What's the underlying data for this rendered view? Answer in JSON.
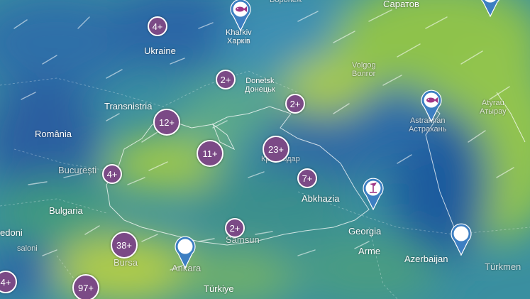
{
  "map": {
    "place_labels": [
      {
        "id": "ukraine",
        "text": "Ukraine"
      },
      {
        "id": "kharkiv",
        "text": "Kharkiv\nХарків"
      },
      {
        "id": "donetsk",
        "text": "Donetsk\nДонецьк"
      },
      {
        "id": "voronezh",
        "text": "Воронеж"
      },
      {
        "id": "saratov",
        "text": "Саратов"
      },
      {
        "id": "volgograd",
        "text": "Volgog\nВолгог"
      },
      {
        "id": "transnistria",
        "text": "Transnistria"
      },
      {
        "id": "romania",
        "text": "România"
      },
      {
        "id": "bucuresti",
        "text": "București"
      },
      {
        "id": "bulgaria",
        "text": "Bulgaria"
      },
      {
        "id": "krasnodar",
        "text": "odar\nКраснодар"
      },
      {
        "id": "astrakhan",
        "text": "Astrakhan\nАстрахань"
      },
      {
        "id": "atyrau",
        "text": "Atyrau\nАтырау"
      },
      {
        "id": "abkhazia",
        "text": "Abkhazia"
      },
      {
        "id": "georgia",
        "text": "Georgia"
      },
      {
        "id": "armenia",
        "text": "Arme"
      },
      {
        "id": "azerbaijan",
        "text": "Azerbaijan"
      },
      {
        "id": "turkmen",
        "text": "Türkmen"
      },
      {
        "id": "samsun",
        "text": "Samsun"
      },
      {
        "id": "ankara",
        "text": "Ankara"
      },
      {
        "id": "bursa",
        "text": "Bursa"
      },
      {
        "id": "turkiye",
        "text": "Türkiye"
      },
      {
        "id": "saloniki",
        "text": "saloni"
      },
      {
        "id": "macedonia",
        "text": "edoni"
      }
    ],
    "clusters": [
      {
        "id": "c1",
        "label": "4+"
      },
      {
        "id": "c2",
        "label": "2+"
      },
      {
        "id": "c3",
        "label": "2+"
      },
      {
        "id": "c4",
        "label": "12+"
      },
      {
        "id": "c5",
        "label": "11+"
      },
      {
        "id": "c6",
        "label": "23+"
      },
      {
        "id": "c7",
        "label": "4+"
      },
      {
        "id": "c8",
        "label": "7+"
      },
      {
        "id": "c9",
        "label": "2+"
      },
      {
        "id": "c10",
        "label": "38+"
      },
      {
        "id": "c11",
        "label": "97+"
      },
      {
        "id": "c12",
        "label": "4+"
      }
    ],
    "pins": [
      {
        "id": "kharkiv-pin",
        "icon": "fish-icon"
      },
      {
        "id": "astrakhan-pin",
        "icon": "fish-icon"
      },
      {
        "id": "georgia-pin",
        "icon": "kitesurf-icon"
      },
      {
        "id": "ankara-pin",
        "icon": "dot-icon"
      },
      {
        "id": "azerbaijan-pin",
        "icon": "dot-icon"
      },
      {
        "id": "topright-pin",
        "icon": "dot-icon"
      }
    ],
    "colors": {
      "cluster": "#7b4a86",
      "pin": "#3d7fc2",
      "fish": "#a03585",
      "wind_low": "#2b6aa8",
      "wind_mid": "#3a9c9a",
      "wind_high": "#a6c84a"
    }
  }
}
